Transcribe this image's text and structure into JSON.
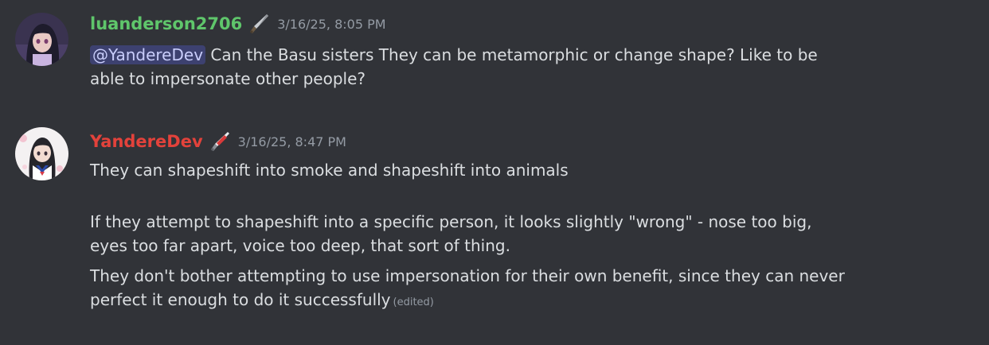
{
  "colors": {
    "background": "#313338",
    "text": "#dbdee1",
    "muted": "#949ba4",
    "user1_name": "#5fc66b",
    "user2_name": "#e3423b",
    "mention_bg": "#414675",
    "mention_text": "#c9cdfb"
  },
  "messages": [
    {
      "username": "luanderson2706",
      "badge_icon": "knife-icon",
      "timestamp": "3/16/25, 8:05 PM",
      "mention": "@YandereDev",
      "line1": " Can the Basu sisters They can be metamorphic or change shape? Like to be",
      "line2": "able to impersonate other people?"
    },
    {
      "username": "YandereDev",
      "badge_icon": "bloody-knife-icon",
      "timestamp": "3/16/25, 8:47 PM",
      "paragraph1": "They can shapeshift into smoke and shapeshift into animals",
      "paragraph2_line1": "If they attempt to shapeshift into a specific person, it looks slightly \"wrong\" - nose too big,",
      "paragraph2_line2": "eyes too far apart, voice too deep, that sort of thing.",
      "paragraph3_line1": "They don't bother attempting to use impersonation for their own benefit, since they can never",
      "paragraph3_line2": "perfect it enough to do it successfully",
      "edited": "(edited)"
    }
  ]
}
